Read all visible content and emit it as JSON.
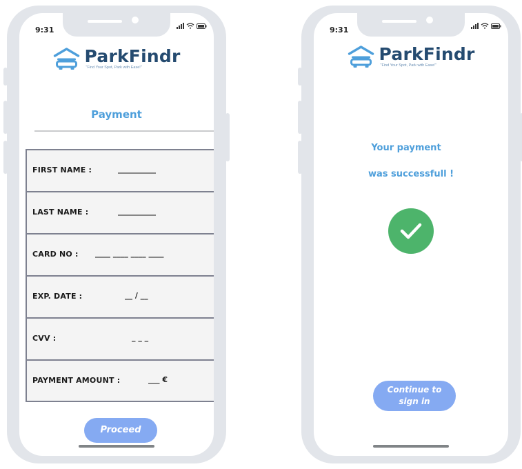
{
  "brand": {
    "name": "ParkFindr",
    "tagline": "\"Find Your Spot, Park with Ease!\"",
    "color": "#254b70"
  },
  "status_bar": {
    "time": "9:31",
    "icons": [
      "signal-icon",
      "wifi-icon",
      "battery-icon"
    ]
  },
  "payment_screen": {
    "title": "Payment",
    "fields": [
      {
        "label": "FIRST NAME :",
        "value": "__________"
      },
      {
        "label": "LAST NAME :",
        "value": "__________"
      },
      {
        "label": "CARD NO :",
        "value": "____ ____ ____ ____"
      },
      {
        "label": "EXP. DATE :",
        "value": "__ / __"
      },
      {
        "label": "CVV :",
        "value": "_ _ _"
      },
      {
        "label": "PAYMENT AMOUNT :",
        "value": "___ €"
      }
    ],
    "proceed_label": "Proceed"
  },
  "success_screen": {
    "line1": "Your payment",
    "line2": "was successfull !",
    "icon": "check-circle-icon",
    "continue_line1": "Continue to",
    "continue_line2": "sign in"
  },
  "colors": {
    "accent": "#4e9fdb",
    "button": "#85aaf2",
    "success": "#4db46b",
    "frame": "#e2e5ea"
  }
}
